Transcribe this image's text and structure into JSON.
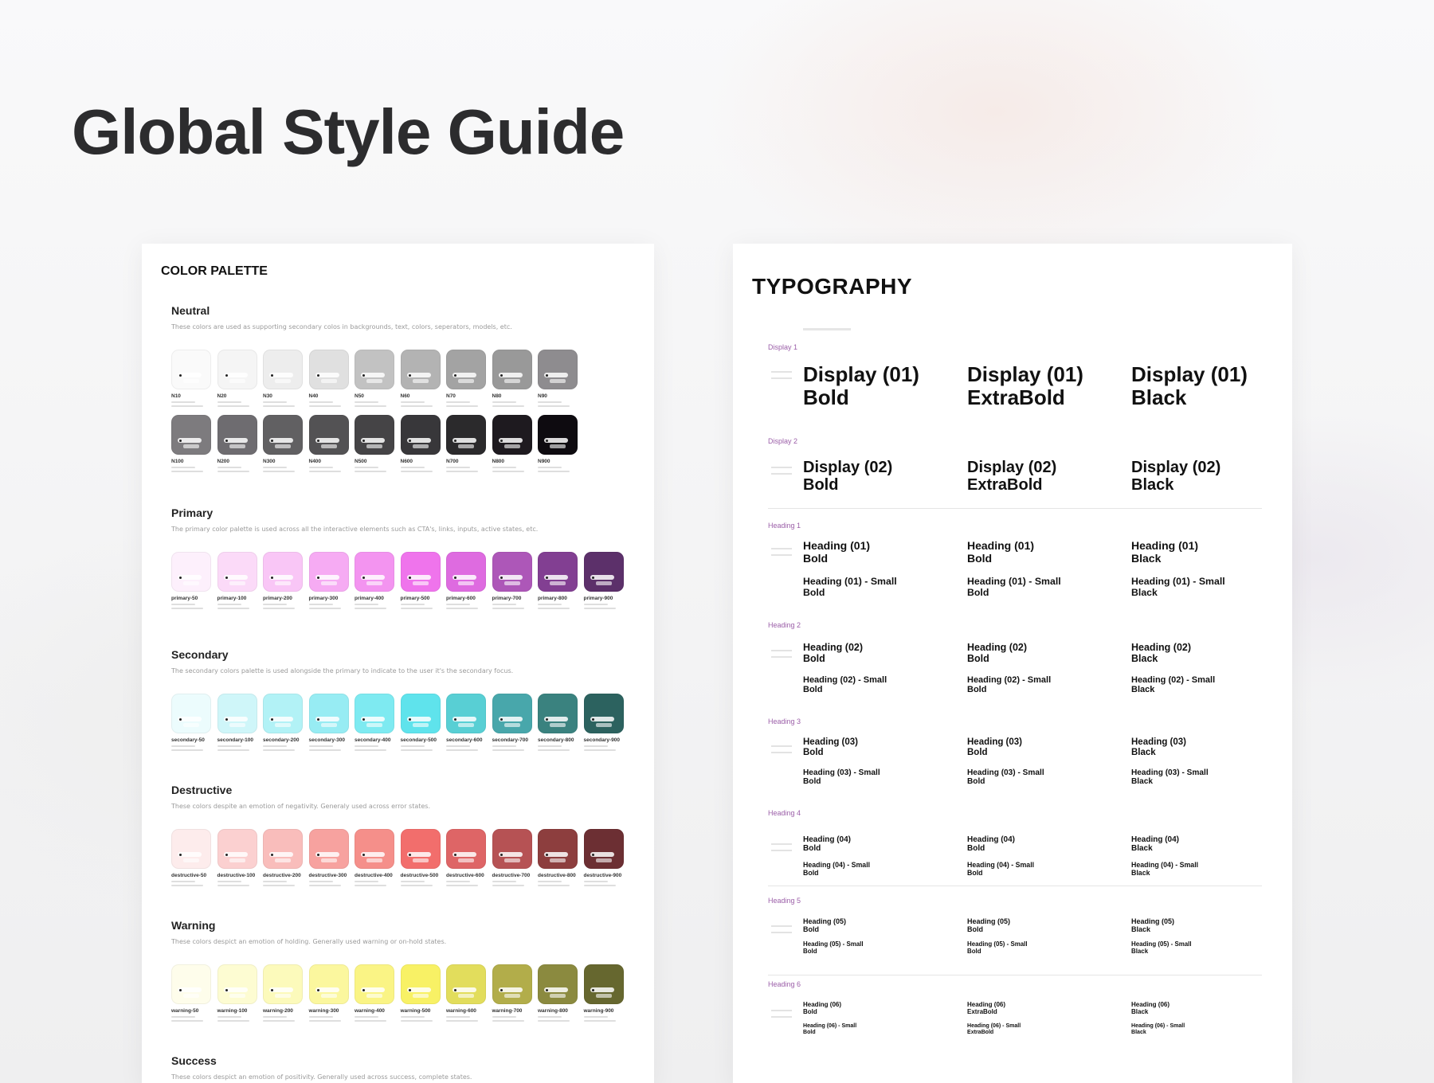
{
  "page_title": "Global Style Guide",
  "color_palette": {
    "title": "COLOR PALETTE",
    "groups": [
      {
        "title": "Neutral",
        "description": "These colors are used as supporting secondary colos in backgrounds, text, colors, seperators, models, etc.",
        "rows": [
          [
            {
              "name": "N10",
              "color": "#fafafa"
            },
            {
              "name": "N20",
              "color": "#f5f5f5"
            },
            {
              "name": "N30",
              "color": "#ededed"
            },
            {
              "name": "N40",
              "color": "#e0e0e0"
            },
            {
              "name": "N50",
              "color": "#c2c2c2"
            },
            {
              "name": "N60",
              "color": "#b3b3b3"
            },
            {
              "name": "N70",
              "color": "#a3a3a3"
            },
            {
              "name": "N80",
              "color": "#999999"
            },
            {
              "name": "N90",
              "color": "#8e8c8f"
            }
          ],
          [
            {
              "name": "N100",
              "color": "#7d7b7e"
            },
            {
              "name": "N200",
              "color": "#6e6c70"
            },
            {
              "name": "N300",
              "color": "#616062"
            },
            {
              "name": "N400",
              "color": "#535254"
            },
            {
              "name": "N500",
              "color": "#454446"
            },
            {
              "name": "N600",
              "color": "#38373a"
            },
            {
              "name": "N700",
              "color": "#2b2a2c"
            },
            {
              "name": "N800",
              "color": "#1e1a1f"
            },
            {
              "name": "N900",
              "color": "#0e0b10"
            }
          ]
        ]
      },
      {
        "title": "Primary",
        "description": "The primary color palette is used across all the interactive elements such as CTA's, links, inputs, active states, etc.",
        "rows": [
          [
            {
              "name": "primary-50",
              "color": "#fdf0fc"
            },
            {
              "name": "primary-100",
              "color": "#fbdaf8"
            },
            {
              "name": "primary-200",
              "color": "#f9c6f6"
            },
            {
              "name": "primary-300",
              "color": "#f6abf3"
            },
            {
              "name": "primary-400",
              "color": "#f394f0"
            },
            {
              "name": "primary-500",
              "color": "#ef74ec"
            },
            {
              "name": "primary-600",
              "color": "#de6be0"
            },
            {
              "name": "primary-700",
              "color": "#ad57b8"
            },
            {
              "name": "primary-800",
              "color": "#823f92"
            },
            {
              "name": "primary-900",
              "color": "#5c306a"
            }
          ]
        ]
      },
      {
        "title": "Secondary",
        "description": "The secondary colors palette is used alongside the primary to indicate to the user it's the secondary focus.",
        "rows": [
          [
            {
              "name": "secondary-50",
              "color": "#ecfcfd"
            },
            {
              "name": "secondary-100",
              "color": "#cff6f9"
            },
            {
              "name": "secondary-200",
              "color": "#b2f2f6"
            },
            {
              "name": "secondary-300",
              "color": "#97ecf3"
            },
            {
              "name": "secondary-400",
              "color": "#7eeaf1"
            },
            {
              "name": "secondary-500",
              "color": "#5fe3ec"
            },
            {
              "name": "secondary-600",
              "color": "#58cfd4"
            },
            {
              "name": "secondary-700",
              "color": "#48a7ab"
            },
            {
              "name": "secondary-800",
              "color": "#3a827f"
            },
            {
              "name": "secondary-900",
              "color": "#2c625f"
            }
          ]
        ]
      },
      {
        "title": "Destructive",
        "description": "These colors despite an emotion of negativity. Generaly used across error states.",
        "rows": [
          [
            {
              "name": "destructive-50",
              "color": "#fdecec"
            },
            {
              "name": "destructive-100",
              "color": "#fbd0d0"
            },
            {
              "name": "destructive-200",
              "color": "#f9bdbb"
            },
            {
              "name": "destructive-300",
              "color": "#f7a29f"
            },
            {
              "name": "destructive-400",
              "color": "#f58f8a"
            },
            {
              "name": "destructive-500",
              "color": "#f26e6c"
            },
            {
              "name": "destructive-600",
              "color": "#de6566"
            },
            {
              "name": "destructive-700",
              "color": "#b65254"
            },
            {
              "name": "destructive-800",
              "color": "#8d3e3e"
            },
            {
              "name": "destructive-900",
              "color": "#6c2f33"
            }
          ]
        ]
      },
      {
        "title": "Warning",
        "description": "These colors despict an emotion of holding. Generally used warning or on-hold states.",
        "rows": [
          [
            {
              "name": "warning-50",
              "color": "#fefdeb"
            },
            {
              "name": "warning-100",
              "color": "#fdfcd2"
            },
            {
              "name": "warning-200",
              "color": "#fcfabb"
            },
            {
              "name": "warning-300",
              "color": "#fbf79e"
            },
            {
              "name": "warning-400",
              "color": "#faf485"
            },
            {
              "name": "warning-500",
              "color": "#f8f165"
            },
            {
              "name": "warning-600",
              "color": "#e2dd5c"
            },
            {
              "name": "warning-700",
              "color": "#b2ad4a"
            },
            {
              "name": "warning-800",
              "color": "#8b8a3f"
            },
            {
              "name": "warning-900",
              "color": "#66672f"
            }
          ]
        ]
      },
      {
        "title": "Success",
        "description": "These colors despict an emotion of positivity. Generally used across success, complete states.",
        "rows": []
      }
    ]
  },
  "typography": {
    "title": "TYPOGRAPHY",
    "sections": [
      {
        "label": "Display 1",
        "size": 26,
        "cells": [
          [
            "Display (01)",
            "Bold"
          ],
          [
            "Display (01)",
            "ExtraBold"
          ],
          [
            "Display (01)",
            "Black"
          ]
        ]
      },
      {
        "label": "Display 2",
        "size": 20,
        "cells": [
          [
            "Display (02)",
            "Bold"
          ],
          [
            "Display (02)",
            "ExtraBold"
          ],
          [
            "Display (02)",
            "Black"
          ]
        ]
      },
      {
        "label": "Heading 1",
        "size": 14,
        "cells": [
          [
            "Heading (01)",
            "Bold",
            "Heading (01) - Small",
            "Bold"
          ],
          [
            "Heading (01)",
            "Bold",
            "Heading (01) - Small",
            "Bold"
          ],
          [
            "Heading (01)",
            "Black",
            "Heading (01) - Small",
            "Black"
          ]
        ]
      },
      {
        "label": "Heading 2",
        "size": 12.5,
        "cells": [
          [
            "Heading (02)",
            "Bold",
            "Heading (02) - Small",
            "Bold"
          ],
          [
            "Heading (02)",
            "Bold",
            "Heading (02) - Small",
            "Bold"
          ],
          [
            "Heading (02)",
            "Black",
            "Heading (02) - Small",
            "Black"
          ]
        ]
      },
      {
        "label": "Heading 3",
        "size": 11.5,
        "cells": [
          [
            "Heading (03)",
            "Bold",
            "Heading (03) - Small",
            "Bold"
          ],
          [
            "Heading (03)",
            "Bold",
            "Heading (03) - Small",
            "Bold"
          ],
          [
            "Heading (03)",
            "Black",
            "Heading (03) - Small",
            "Black"
          ]
        ]
      },
      {
        "label": "Heading 4",
        "size": 10,
        "cells": [
          [
            "Heading (04)",
            "Bold",
            "Heading (04) - Small",
            "Bold"
          ],
          [
            "Heading (04)",
            "Bold",
            "Heading (04) - Small",
            "Bold"
          ],
          [
            "Heading (04)",
            "Black",
            "Heading (04) - Small",
            "Black"
          ]
        ]
      },
      {
        "label": "Heading 5",
        "size": 9,
        "cells": [
          [
            "Heading (05)",
            "Bold",
            "Heading (05) - Small",
            "Bold"
          ],
          [
            "Heading (05)",
            "Bold",
            "Heading (05) - Small",
            "Bold"
          ],
          [
            "Heading (05)",
            "Black",
            "Heading (05) - Small",
            "Black"
          ]
        ]
      },
      {
        "label": "Heading 6",
        "size": 8,
        "cells": [
          [
            "Heading (06)",
            "Bold",
            "Heading (06) - Small",
            "Bold"
          ],
          [
            "Heading (06)",
            "ExtraBold",
            "Heading (06) - Small",
            "ExtraBold"
          ],
          [
            "Heading (06)",
            "Black",
            "Heading (06) - Small",
            "Black"
          ]
        ]
      }
    ]
  }
}
